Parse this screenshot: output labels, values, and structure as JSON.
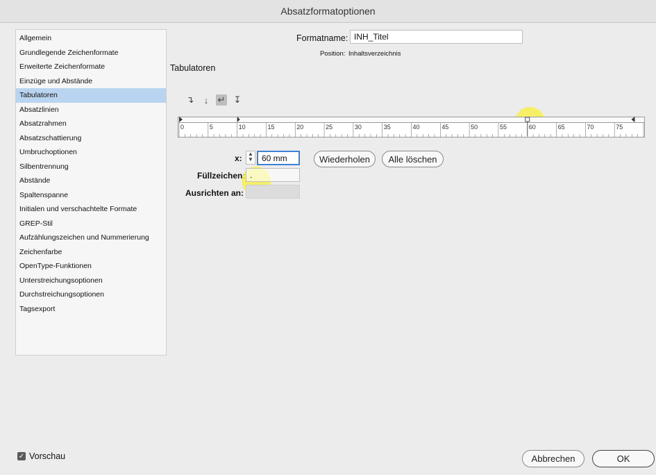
{
  "window": {
    "title": "Absatzformatoptionen"
  },
  "sidebar": {
    "items": [
      {
        "label": "Allgemein",
        "selected": false
      },
      {
        "label": "Grundlegende Zeichenformate",
        "selected": false
      },
      {
        "label": "Erweiterte Zeichenformate",
        "selected": false
      },
      {
        "label": "Einzüge und Abstände",
        "selected": false
      },
      {
        "label": "Tabulatoren",
        "selected": true
      },
      {
        "label": "Absatzlinien",
        "selected": false
      },
      {
        "label": "Absatzrahmen",
        "selected": false
      },
      {
        "label": "Absatzschattierung",
        "selected": false
      },
      {
        "label": "Umbruchoptionen",
        "selected": false
      },
      {
        "label": "Silbentrennung",
        "selected": false
      },
      {
        "label": "Abstände",
        "selected": false
      },
      {
        "label": "Spaltenspanne",
        "selected": false
      },
      {
        "label": "Initialen und verschachtelte Formate",
        "selected": false
      },
      {
        "label": "GREP-Stil",
        "selected": false
      },
      {
        "label": "Aufzählungszeichen und Nummerierung",
        "selected": false
      },
      {
        "label": "Zeichenfarbe",
        "selected": false
      },
      {
        "label": "OpenType-Funktionen",
        "selected": false
      },
      {
        "label": "Unterstreichungsoptionen",
        "selected": false
      },
      {
        "label": "Durchstreichungsoptionen",
        "selected": false
      },
      {
        "label": "Tagsexport",
        "selected": false
      }
    ]
  },
  "header": {
    "formatname_label": "Formatname:",
    "formatname_value": "INH_Titel",
    "position_label": "Position:",
    "position_value": "Inhaltsverzeichnis"
  },
  "section": {
    "title": "Tabulatoren"
  },
  "tab_align_icons": [
    "align-left-tab-icon",
    "align-center-tab-icon",
    "align-right-tab-icon",
    "align-decimal-tab-icon"
  ],
  "ruler": {
    "labels": [
      "0",
      "5",
      "10",
      "15",
      "20",
      "25",
      "30",
      "35",
      "40",
      "45",
      "50",
      "55",
      "60",
      "65",
      "70",
      "75"
    ],
    "max_mm": 80,
    "tab_stop_mm": 60,
    "left_indent_mm": 0,
    "first_line_indent_mm": 10,
    "right_indent_mm": 78.5
  },
  "tab_settings": {
    "x_label": "x:",
    "x_value": "60 mm",
    "repeat_button": "Wiederholen",
    "clear_all_button": "Alle löschen",
    "fill_label": "Füllzeichen:",
    "fill_value": ".",
    "align_on_label": "Ausrichten an:",
    "align_on_value": ""
  },
  "footer": {
    "preview_label": "Vorschau",
    "preview_checked": true,
    "cancel_button": "Abbrechen",
    "ok_button": "OK"
  },
  "colors": {
    "selection": "#b9d4f0",
    "highlight": "#faf03c",
    "focus": "#3b82d6"
  }
}
